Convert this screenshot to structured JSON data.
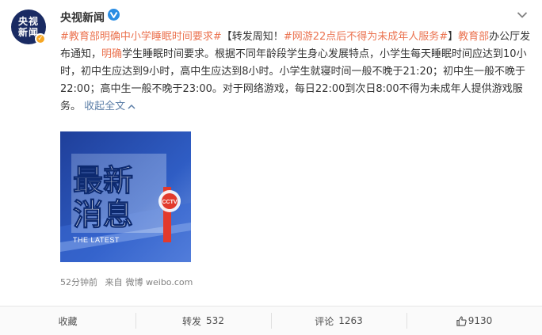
{
  "author": {
    "avatar_line1": "央视",
    "avatar_line2": "新闻",
    "name": "央视新闻"
  },
  "post": {
    "tag1": "#教育部明确中小学睡眠时间要求#",
    "text1": "【转发周知！",
    "tag2": "#网游22点后不得为未成年人服务#",
    "text2": "】",
    "mention": "教育部",
    "text3": "办公厅发布通知，",
    "tag3": "明确",
    "text4": "学生睡眠时间要求。根据不同年龄段学生身心发展特点，小学生每天睡眠时间应达到10小时，初中生应达到9小时，高中生应达到8小时。小学生就寝时间一般不晚于21:20；初中生一般不晚于22:00；高中生一般不晚于23:00。对于网络游戏，每日22:00到次日8:00不得为未成年人提供游戏服务。",
    "collapse": "收起全文"
  },
  "image": {
    "headline_line1": "最新",
    "headline_line2": "消息",
    "subtitle": "THE LATEST",
    "logo_text": "CCTV"
  },
  "meta": {
    "time": "52分钟前",
    "source_prefix": "来自",
    "source": "微博 weibo.com"
  },
  "actions": {
    "favorite": "收藏",
    "repost_label": "转发",
    "repost_count": "532",
    "comment_label": "评论",
    "comment_count": "1263",
    "like_count": "9130"
  },
  "colors": {
    "tag": "#eb7350",
    "link": "#5d7fa8",
    "vip": "#2b8de3",
    "avatar_bg": "#1a2b63"
  },
  "icons": [
    "vip-verified-icon",
    "dropdown-menu-icon",
    "verified-badge-icon",
    "chevron-up-icon",
    "thumbs-up-icon"
  ]
}
